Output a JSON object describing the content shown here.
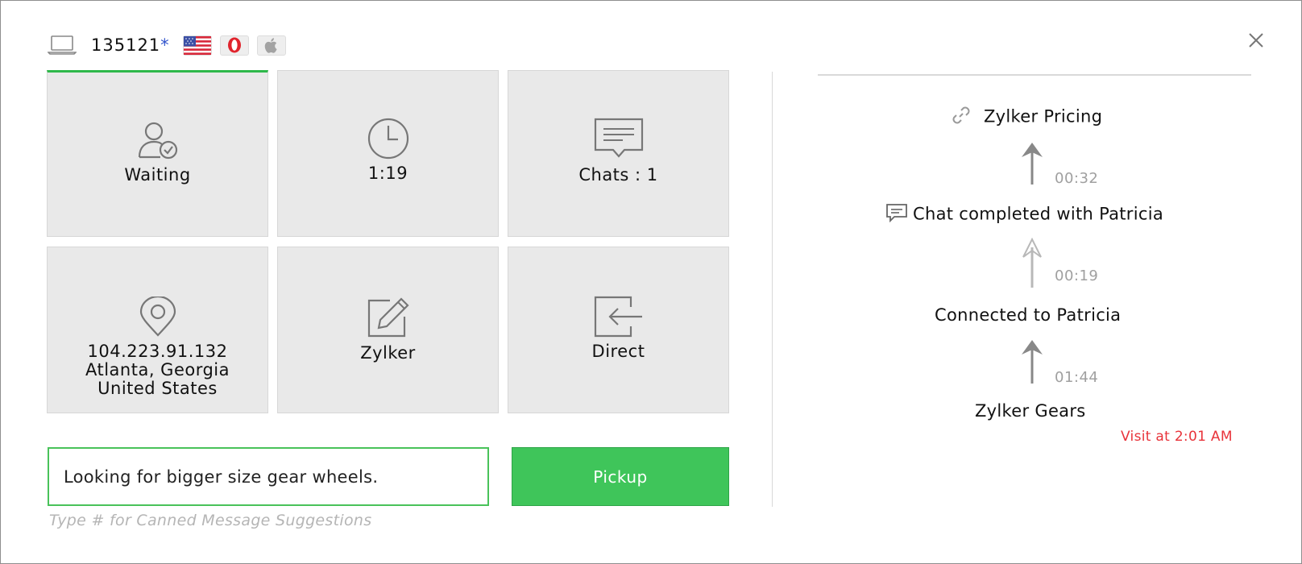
{
  "header": {
    "visitor_id": "135121",
    "asterisk": "*",
    "device_icon": "laptop-icon",
    "badges": [
      "us-flag-icon",
      "opera-browser-icon",
      "apple-os-icon"
    ],
    "close_icon": "close-icon"
  },
  "tiles": [
    {
      "icon": "user-check-icon",
      "label": "Waiting"
    },
    {
      "icon": "clock-icon",
      "label": "1:19"
    },
    {
      "icon": "chat-icon",
      "label": "Chats : 1"
    },
    {
      "icon": "location-pin-icon",
      "lines": [
        "104.223.91.132",
        "Atlanta, Georgia",
        "United States"
      ]
    },
    {
      "icon": "edit-icon",
      "label": "Zylker"
    },
    {
      "icon": "sign-in-icon",
      "label": "Direct"
    }
  ],
  "message": {
    "text": "Looking for bigger size gear wheels.",
    "hint": "Type # for Canned Message Suggestions"
  },
  "pickup_label": "Pickup",
  "timeline": {
    "events": [
      {
        "icon": "link-icon",
        "label": "Zylker Pricing"
      },
      {
        "icon": "chat-icon",
        "label": "Chat completed with Patricia"
      },
      {
        "icon": "",
        "label": "Connected to Patricia"
      },
      {
        "icon": "",
        "label": "Zylker Gears"
      }
    ],
    "durations": [
      "00:32",
      "00:19",
      "01:44"
    ],
    "visit_time": "Visit at 2:01 AM"
  },
  "colors": {
    "accent_green": "#3fc55a",
    "visit_red": "#e8333a",
    "tile_bg": "#e9e9e9"
  }
}
